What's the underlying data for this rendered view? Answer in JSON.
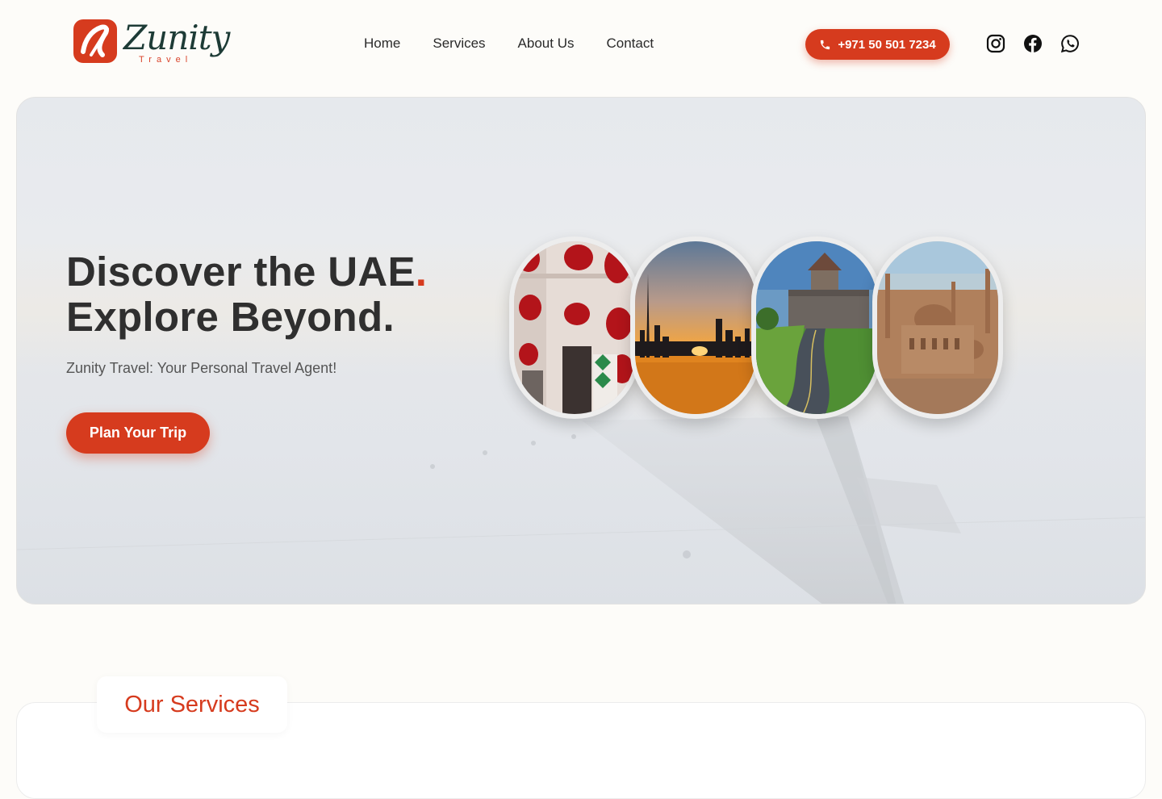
{
  "brand": {
    "name": "Zunity",
    "tagline": "Travel",
    "accent_color": "#d63b1e",
    "dark_color": "#1d3b36"
  },
  "nav": {
    "items": [
      {
        "label": "Home"
      },
      {
        "label": "Services"
      },
      {
        "label": "About Us"
      },
      {
        "label": "Contact"
      }
    ]
  },
  "contact": {
    "phone": "+971 50 501 7234",
    "phone_icon": "phone-icon"
  },
  "social": [
    {
      "name": "instagram-icon"
    },
    {
      "name": "facebook-icon"
    },
    {
      "name": "whatsapp-icon"
    }
  ],
  "hero": {
    "title_line1": "Discover the UAE",
    "title_dot": ".",
    "title_line2": "Explore Beyond.",
    "subtitle": "Zunity Travel: Your Personal Travel Agent!",
    "cta_label": "Plan Your Trip",
    "photos": [
      {
        "name": "photo-flower-street"
      },
      {
        "name": "photo-dubai-sunset"
      },
      {
        "name": "photo-castle-road"
      },
      {
        "name": "photo-cairo-mosques"
      }
    ]
  },
  "services": {
    "heading": "Our Services"
  }
}
